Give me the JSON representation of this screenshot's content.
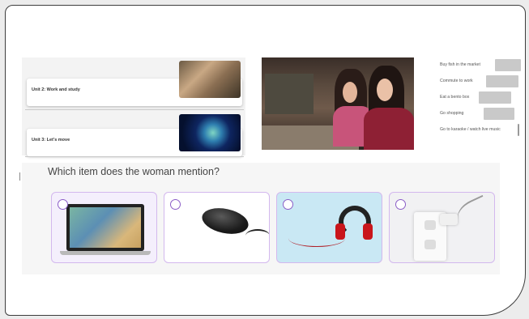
{
  "units": [
    {
      "label": "Unit 2: Work and study"
    },
    {
      "label": "Unit 3: Let's move"
    }
  ],
  "activities": [
    {
      "label": "Buy fish in the market"
    },
    {
      "label": "Commute to work"
    },
    {
      "label": "Eat a bento box"
    },
    {
      "label": "Go shopping"
    },
    {
      "label": "Go to karaoke / watch live music"
    }
  ],
  "question": {
    "text": "Which item does the woman mention?",
    "options": [
      {
        "item": "laptop-image"
      },
      {
        "item": "mouse-image"
      },
      {
        "item": "headphones-image"
      },
      {
        "item": "power-outlet-image"
      }
    ]
  },
  "colors": {
    "radio_border": "#8a5cc6",
    "option_border": "#d3b8ee",
    "headphones_bg": "#c9e8f4"
  }
}
